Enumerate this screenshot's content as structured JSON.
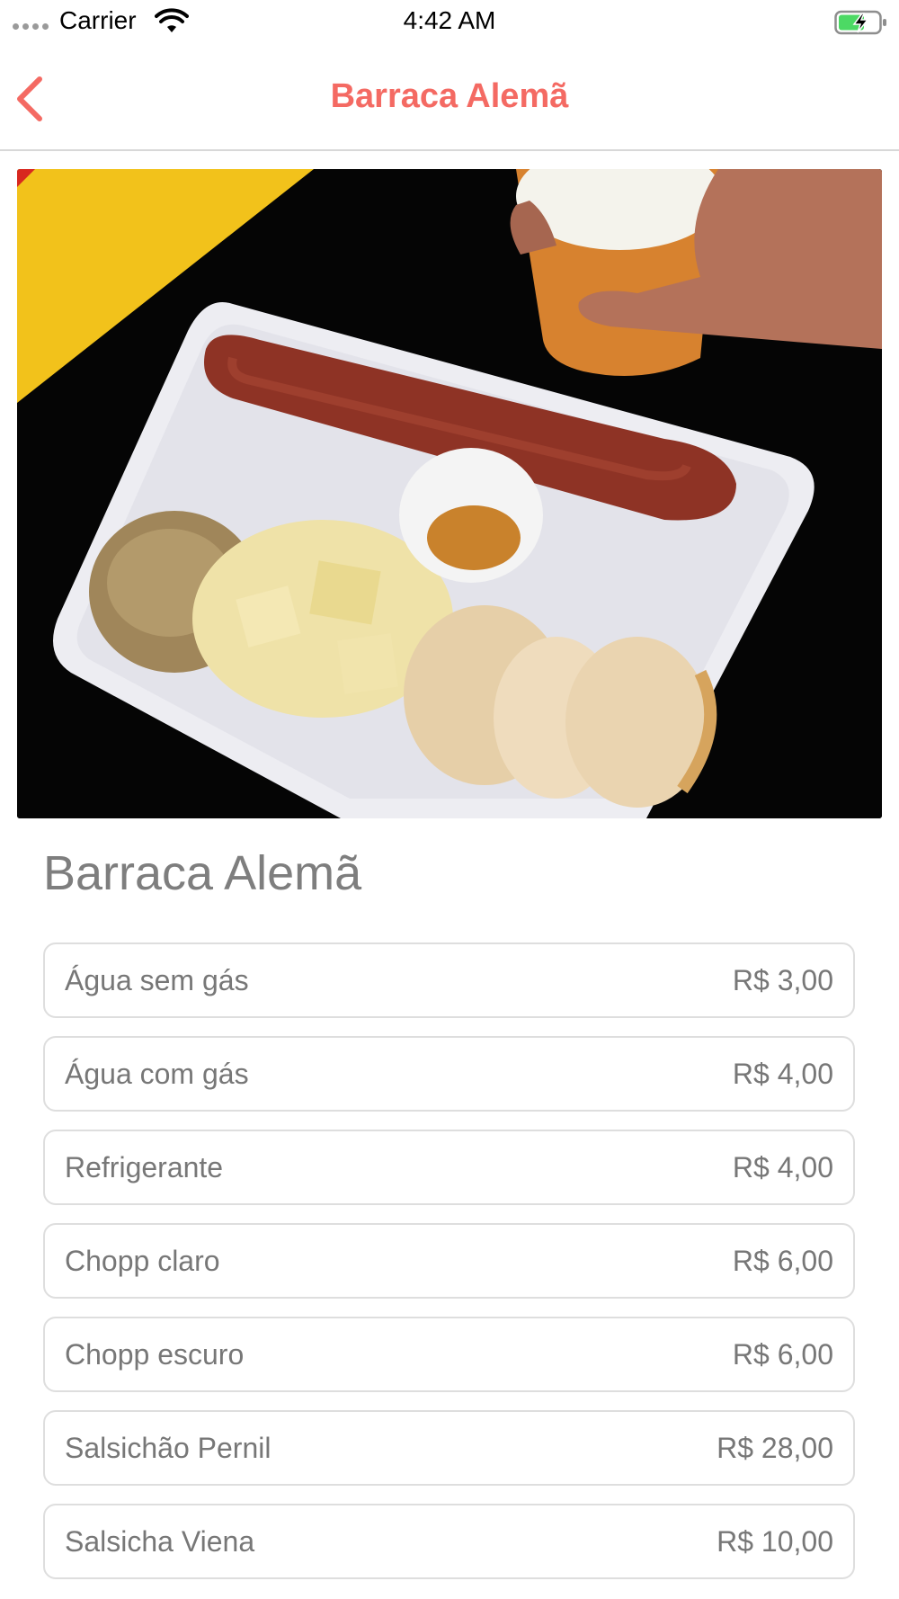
{
  "status_bar": {
    "carrier": "Carrier",
    "time": "4:42 AM",
    "icons": [
      "signal-dots-icon",
      "wifi-icon",
      "battery-charging-icon"
    ],
    "battery_color": "#4cd964"
  },
  "nav": {
    "title": "Barraca Alemã",
    "back_icon": "chevron-left-icon",
    "accent_color": "#f46a63"
  },
  "hero_image": {
    "subject": "food-photo"
  },
  "main": {
    "title": "Barraca Alemã",
    "items": [
      {
        "name": "Água sem gás",
        "price": "R$ 3,00"
      },
      {
        "name": "Água com gás",
        "price": "R$ 4,00"
      },
      {
        "name": "Refrigerante",
        "price": "R$ 4,00"
      },
      {
        "name": "Chopp claro",
        "price": "R$ 6,00"
      },
      {
        "name": "Chopp escuro",
        "price": "R$ 6,00"
      },
      {
        "name": "Salsichão Pernil",
        "price": "R$ 28,00"
      },
      {
        "name": "Salsicha Viena",
        "price": "R$ 10,00"
      }
    ]
  }
}
